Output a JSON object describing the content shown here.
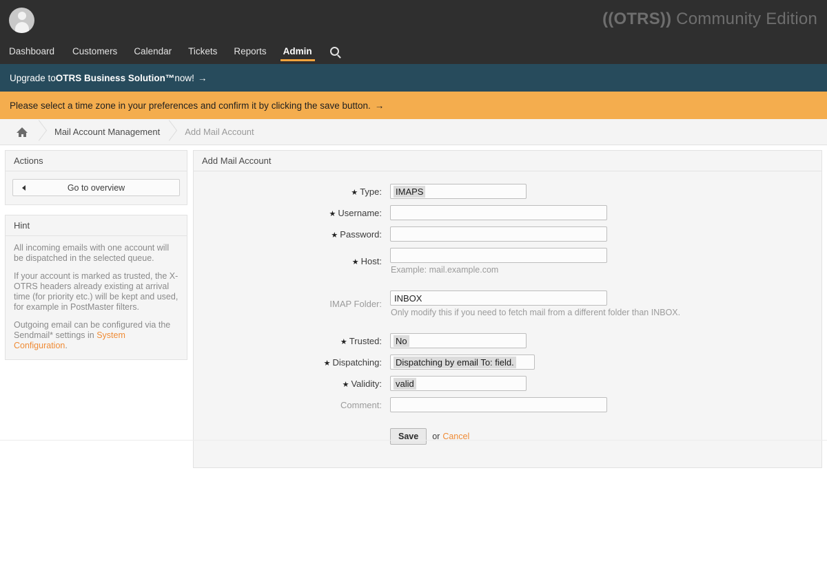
{
  "topnav": {
    "avatar_icon": "user-avatar-icon",
    "brand_mark": "((OTRS))",
    "brand_suffix": " Community Edition",
    "items": [
      {
        "label": "Dashboard",
        "active": false
      },
      {
        "label": "Customers",
        "active": false
      },
      {
        "label": "Calendar",
        "active": false
      },
      {
        "label": "Tickets",
        "active": false
      },
      {
        "label": "Reports",
        "active": false
      },
      {
        "label": "Admin",
        "active": true
      }
    ],
    "search_icon": "search-icon"
  },
  "notifications": {
    "upgrade": {
      "prefix": "Upgrade to ",
      "strong": "OTRS Business Solution™",
      "suffix": " now!",
      "arrow": "→",
      "bg": "#274b5c"
    },
    "timezone": {
      "text": "Please select a time zone in your preferences and confirm it by clicking the save button.",
      "arrow": "→",
      "bg": "#f4ad4e"
    }
  },
  "breadcrumb": {
    "home_icon": "home-icon",
    "items": [
      {
        "label": "Mail Account Management",
        "current": false
      },
      {
        "label": "Add Mail Account",
        "current": true
      }
    ]
  },
  "sidebar": {
    "actions": {
      "title": "Actions",
      "overview_button": "Go to overview",
      "overview_caret_icon": "chevron-left-icon"
    },
    "hint": {
      "title": "Hint",
      "paragraph_1": "All incoming emails with one account will be dispatched in the selected queue.",
      "paragraph_2": "If your account is marked as trusted, the X-OTRS headers already existing at arrival time (for priority etc.) will be kept and used, for example in PostMaster filters.",
      "paragraph_3_prefix": "Outgoing email can be configured via the Sendmail* settings in ",
      "paragraph_3_link": "System Configuration",
      "paragraph_3_suffix": "."
    }
  },
  "main": {
    "panel_title": "Add Mail Account",
    "fields": {
      "type": {
        "label": "Type:",
        "required": true,
        "value": "IMAPS"
      },
      "username": {
        "label": "Username:",
        "required": true,
        "value": "",
        "placeholder": ""
      },
      "password": {
        "label": "Password:",
        "required": true,
        "value": "",
        "placeholder": ""
      },
      "host": {
        "label": "Host:",
        "required": true,
        "value": "",
        "placeholder": "",
        "helper": "Example: mail.example.com"
      },
      "imap_folder": {
        "label": "IMAP Folder:",
        "required": false,
        "value": "INBOX",
        "helper": "Only modify this if you need to fetch mail from a different folder than INBOX."
      },
      "trusted": {
        "label": "Trusted:",
        "required": true,
        "value": "No"
      },
      "dispatching": {
        "label": "Dispatching:",
        "required": true,
        "value": "Dispatching by email To: field."
      },
      "validity": {
        "label": "Validity:",
        "required": true,
        "value": "valid"
      },
      "comment": {
        "label": "Comment:",
        "required": false,
        "value": "",
        "placeholder": ""
      }
    },
    "submit": {
      "save_label": "Save",
      "or_label": "or",
      "cancel_label": "Cancel"
    }
  },
  "colors": {
    "accent_orange": "#ef8b35",
    "nav_active_underline": "#f2a33c",
    "topbar_bg": "#2f2f2f",
    "upgrade_bar_bg": "#274b5c",
    "timezone_bar_bg": "#f4ad4e"
  },
  "star_glyph": "★"
}
